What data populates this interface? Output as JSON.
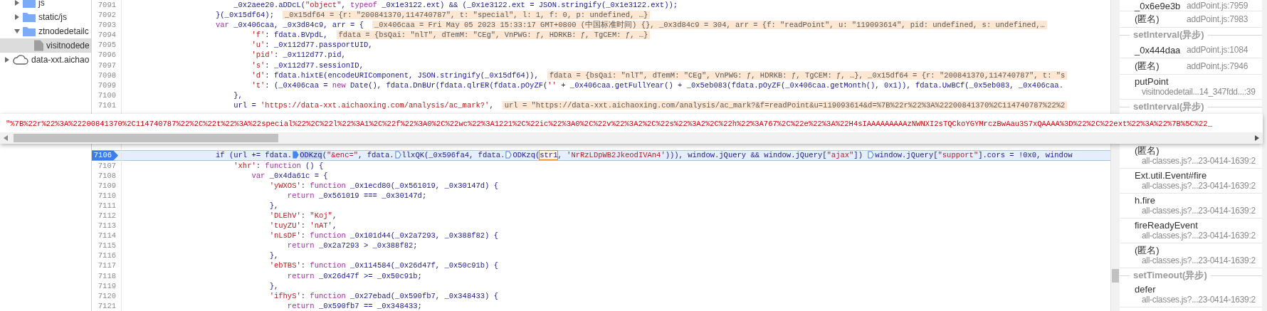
{
  "sidebar": {
    "items": [
      {
        "kind": "folder",
        "label": "js",
        "expanded": false,
        "selected": false
      },
      {
        "kind": "folder",
        "label": "static/js",
        "expanded": false,
        "selected": false
      },
      {
        "kind": "folder",
        "label": "ztnodedetailc",
        "expanded": true,
        "selected": false,
        "children": [
          {
            "kind": "file",
            "label": "visitnodede",
            "selected": true
          }
        ]
      },
      {
        "kind": "origin",
        "label": "data-xxt.aichao",
        "expanded": false,
        "selected": false
      }
    ]
  },
  "editor": {
    "lines": [
      {
        "number": "7091",
        "current": false,
        "tokens": [
          {
            "kind": "code",
            "text": "                        _0x2aee20.aDDcL("
          },
          {
            "kind": "string",
            "text": "\"object\""
          },
          {
            "kind": "code",
            "text": ", "
          },
          {
            "kind": "keyword",
            "text": "typeof"
          },
          {
            "kind": "code",
            "text": " _0x1e3122.ext) && (_0x1e3122.ext = JSON.stringify(_0x1e3122.ext));"
          }
        ]
      },
      {
        "number": "7092",
        "current": false,
        "tokens": [
          {
            "kind": "code",
            "text": "                    }(_0x15df64);"
          },
          {
            "kind": "hint",
            "text": "_0x15df64 = {r: \"200841370,114740787\", t: \"special\", l: 1, f: 0, p: undefined, …}"
          }
        ]
      },
      {
        "number": "7093",
        "current": false,
        "tokens": [
          {
            "kind": "keyword",
            "text": "                    var"
          },
          {
            "kind": "code",
            "text": " _0x406caa, _0x3d84c9, arr = {"
          },
          {
            "kind": "hint",
            "text": "_0x406caa = Fri May 05 2023 15:33:17 GMT+0800 (中国标准时间) {}, _0x3d84c9 = 304, arr = {f: \"readPoint\", u: \"119093614\", pid: undefined, s: undefined,…"
          }
        ]
      },
      {
        "number": "7094",
        "current": false,
        "tokens": [
          {
            "kind": "string",
            "text": "                            'f'"
          },
          {
            "kind": "code",
            "text": ": fdata.BVpdL,"
          },
          {
            "kind": "hint",
            "text": "fdata = {bsQai: \"nlT\", dTemM: \"CEg\", VnPWG: ƒ, HDRKB: ƒ, TgCEM: ƒ, …}"
          }
        ]
      },
      {
        "number": "7095",
        "current": false,
        "tokens": [
          {
            "kind": "string",
            "text": "                            'u'"
          },
          {
            "kind": "code",
            "text": ": _0x112d77.passportUID,"
          }
        ]
      },
      {
        "number": "7096",
        "current": false,
        "tokens": [
          {
            "kind": "string",
            "text": "                            'pid'"
          },
          {
            "kind": "code",
            "text": ": _0x112d77.pid,"
          }
        ]
      },
      {
        "number": "7097",
        "current": false,
        "tokens": [
          {
            "kind": "string",
            "text": "                            's'"
          },
          {
            "kind": "code",
            "text": ": _0x112d77.sessionID,"
          }
        ]
      },
      {
        "number": "7098",
        "current": false,
        "tokens": [
          {
            "kind": "string",
            "text": "                            'd'"
          },
          {
            "kind": "code",
            "text": ": fdata.hixtE(encodeURIComponent, JSON.stringify(_0x15df64)),"
          },
          {
            "kind": "hint",
            "text": "fdata = {bsQai: \"nlT\", dTemM: \"CEg\", VnPWG: ƒ, HDRKB: ƒ, TgCEM: ƒ, …}, _0x15df64 = {r: \"200841370,114740787\", t: \"s"
          }
        ]
      },
      {
        "number": "7099",
        "current": false,
        "tokens": [
          {
            "kind": "string",
            "text": "                            't'"
          },
          {
            "kind": "code",
            "text": ": (_0x406caa = "
          },
          {
            "kind": "keyword",
            "text": "new"
          },
          {
            "kind": "code",
            "text": " Date(), fdata.DnBUr(fdata.qlrER(fdata.pOyZF("
          },
          {
            "kind": "string",
            "text": "''"
          },
          {
            "kind": "code",
            "text": " + _0x406caa.getFullYear() + _0x5eb083(fdata.pOyZF(_0x406caa.getMonth(), 0x1)), fdata.UwBCf(_0x5eb083, _0x406caa."
          }
        ]
      },
      {
        "number": "7100",
        "current": false,
        "tokens": [
          {
            "kind": "code",
            "text": "                        },"
          }
        ]
      },
      {
        "number": "7101",
        "current": false,
        "tokens": [
          {
            "kind": "code",
            "text": "                        url = "
          },
          {
            "kind": "string",
            "text": "'https://data-xxt.aichaoxing.com/analysis/ac_mark?'"
          },
          {
            "kind": "code",
            "text": ","
          },
          {
            "kind": "hint",
            "text": "url = \"https://data-xxt.aichaoxing.com/analysis/ac_mark?&f=readPoint&u=119093614&d=%7B%22r%22%3A%22200841370%2C114740787%22%2"
          }
        ]
      },
      {
        "number": "7106",
        "current": true,
        "tokens": [
          {
            "kind": "code",
            "text": "                    if (url += fdata."
          },
          {
            "kind": "marker",
            "active": true
          },
          {
            "kind": "selected",
            "text": "ODKzq"
          },
          {
            "kind": "code",
            "text": "("
          },
          {
            "kind": "string",
            "text": "\"&enc=\""
          },
          {
            "kind": "code",
            "text": ", fdata."
          },
          {
            "kind": "marker",
            "active": false
          },
          {
            "kind": "code",
            "text": "llxQK(_0x596fa4, fdata."
          },
          {
            "kind": "marker",
            "active": false
          },
          {
            "kind": "code",
            "text": "ODKzq("
          },
          {
            "kind": "boxed",
            "text": "str1"
          },
          {
            "kind": "code",
            "text": ", "
          },
          {
            "kind": "string",
            "text": "'NrRzLDpWB2JkeodIVAn4'"
          },
          {
            "kind": "code",
            "text": "))), window.jQuery && window.jQuery["
          },
          {
            "kind": "string",
            "text": "\"ajax\""
          },
          {
            "kind": "code",
            "text": "]) "
          },
          {
            "kind": "marker",
            "active": false
          },
          {
            "kind": "code",
            "text": "window.jQuery["
          },
          {
            "kind": "string",
            "text": "\"support\""
          },
          {
            "kind": "code",
            "text": "].cors = !0x0, window"
          }
        ]
      },
      {
        "number": "7107",
        "current": false,
        "tokens": [
          {
            "kind": "string",
            "text": "                        'xhr'"
          },
          {
            "kind": "code",
            "text": ": "
          },
          {
            "kind": "keyword",
            "text": "function"
          },
          {
            "kind": "code",
            "text": " () {"
          }
        ]
      },
      {
        "number": "7108",
        "current": false,
        "tokens": [
          {
            "kind": "keyword",
            "text": "                            var"
          },
          {
            "kind": "code",
            "text": " _0x4da61c = {"
          }
        ]
      },
      {
        "number": "7109",
        "current": false,
        "tokens": [
          {
            "kind": "string",
            "text": "                                'yWXOS'"
          },
          {
            "kind": "code",
            "text": ": "
          },
          {
            "kind": "keyword",
            "text": "function"
          },
          {
            "kind": "code",
            "text": " _0x1ecd80(_0x561019, _0x30147d) {"
          }
        ]
      },
      {
        "number": "7110",
        "current": false,
        "tokens": [
          {
            "kind": "keyword",
            "text": "                                    return"
          },
          {
            "kind": "code",
            "text": " _0x561019 === _0x30147d;"
          }
        ]
      },
      {
        "number": "7111",
        "current": false,
        "tokens": [
          {
            "kind": "code",
            "text": "                                },"
          }
        ]
      },
      {
        "number": "7112",
        "current": false,
        "tokens": [
          {
            "kind": "string",
            "text": "                                'DLEhV'"
          },
          {
            "kind": "code",
            "text": ": "
          },
          {
            "kind": "string",
            "text": "\"Koj\""
          },
          {
            "kind": "code",
            "text": ","
          }
        ]
      },
      {
        "number": "7113",
        "current": false,
        "tokens": [
          {
            "kind": "string",
            "text": "                                'tuyZU'"
          },
          {
            "kind": "code",
            "text": ": "
          },
          {
            "kind": "string",
            "text": "'nAT'"
          },
          {
            "kind": "code",
            "text": ","
          }
        ]
      },
      {
        "number": "7114",
        "current": false,
        "tokens": [
          {
            "kind": "string",
            "text": "                                'nLsDF'"
          },
          {
            "kind": "code",
            "text": ": "
          },
          {
            "kind": "keyword",
            "text": "function"
          },
          {
            "kind": "code",
            "text": " _0x101d44(_0x2a7293, _0x388f82) {"
          }
        ]
      },
      {
        "number": "7115",
        "current": false,
        "tokens": [
          {
            "kind": "keyword",
            "text": "                                    return"
          },
          {
            "kind": "code",
            "text": " _0x2a7293 > _0x388f82;"
          }
        ]
      },
      {
        "number": "7116",
        "current": false,
        "tokens": [
          {
            "kind": "code",
            "text": "                                },"
          }
        ]
      },
      {
        "number": "7117",
        "current": false,
        "tokens": [
          {
            "kind": "string",
            "text": "                                'ebTBS'"
          },
          {
            "kind": "code",
            "text": ": "
          },
          {
            "kind": "keyword",
            "text": "function"
          },
          {
            "kind": "code",
            "text": " _0x114584(_0x26d47f, _0x50c91b) {"
          }
        ]
      },
      {
        "number": "7118",
        "current": false,
        "tokens": [
          {
            "kind": "keyword",
            "text": "                                    return"
          },
          {
            "kind": "code",
            "text": " _0x26d47f >= _0x50c91b;"
          }
        ]
      },
      {
        "number": "7119",
        "current": false,
        "tokens": [
          {
            "kind": "code",
            "text": "                                },"
          }
        ]
      },
      {
        "number": "7120",
        "current": false,
        "tokens": [
          {
            "kind": "string",
            "text": "                                'ifhyS'"
          },
          {
            "kind": "code",
            "text": ": "
          },
          {
            "kind": "keyword",
            "text": "function"
          },
          {
            "kind": "code",
            "text": " _0x27ebad(_0x590fb7, _0x348433) {"
          }
        ]
      },
      {
        "number": "7121",
        "current": false,
        "tokens": [
          {
            "kind": "keyword",
            "text": "                                    return"
          },
          {
            "kind": "code",
            "text": " _0x590fb7 == _0x348433;"
          }
        ]
      }
    ]
  },
  "value_popover": {
    "text": "\"%7B%22r%22%3A%22200841370%2C114740787%22%2C%22t%22%3A%22special%22%2C%22l%22%3A1%2C%22f%22%3A0%2C%22wc%22%3A1221%2C%22ic%22%3A0%2C%22v%22%3A2%2C%22s%22%3A2%2C%22h%22%3A767%2C%22e%22%3A%22H4sIAAAAAAAAAzNWNXI2sTQCkoYGYMrczBwAau3S7xQAAAA%3D%22%2C%22ext%22%3A%22%7B%5C%22_"
  },
  "call_stack": {
    "items": [
      {
        "kind": "frame",
        "name": "_0x6e9e3b",
        "location": "addPoint.js:7959"
      },
      {
        "kind": "frame",
        "name": "(匿名)",
        "location": "addPoint.js:7983"
      },
      {
        "kind": "async",
        "label": "setInterval(异步)"
      },
      {
        "kind": "frame",
        "name": "_0x444daa",
        "location": "addPoint.js:1084"
      },
      {
        "kind": "frame",
        "name": "(匿名)",
        "location": "addPoint.js:7946"
      },
      {
        "kind": "frame-wide",
        "name": "putPoint",
        "location": "visitnodedetail...14_347fdd...:39"
      },
      {
        "kind": "async",
        "label": "setInterval(异步)"
      },
      {
        "kind": "hidden"
      },
      {
        "kind": "frame-wide",
        "name": "(匿名)",
        "location": "all-classes.js?...23-0414-1639:2"
      },
      {
        "kind": "frame-wide",
        "name": "Ext.util.Event#fire",
        "location": "all-classes.js?...23-0414-1639:2"
      },
      {
        "kind": "frame-wide",
        "name": "h.fire",
        "location": "all-classes.js?...23-0414-1639:2"
      },
      {
        "kind": "frame-wide",
        "name": "fireReadyEvent",
        "location": "all-classes.js?...23-0414-1639:2"
      },
      {
        "kind": "frame-wide",
        "name": "(匿名)",
        "location": "all-classes.js?...23-0414-1639:2"
      },
      {
        "kind": "async",
        "label": "setTimeout(异步)"
      },
      {
        "kind": "frame-wide",
        "name": "defer",
        "location": "all-classes.js?...23-0414-1639:2"
      }
    ]
  }
}
